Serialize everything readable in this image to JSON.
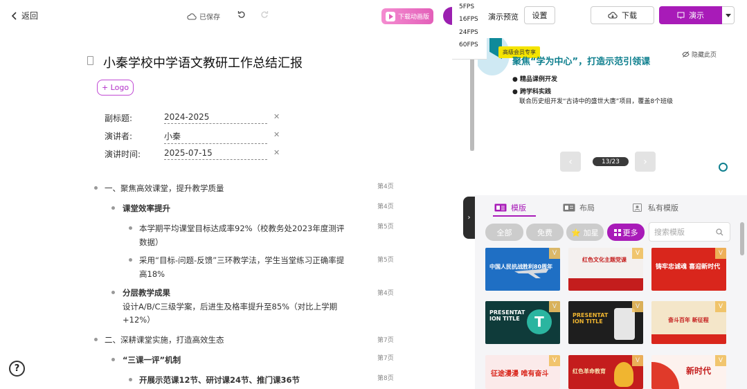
{
  "topbar": {
    "back_label": "返回",
    "saved_label": "已保存",
    "download_ppt_label": "下载动画版"
  },
  "outline": {
    "title": "小秦学校中学语文教研工作总结汇报",
    "logo_button": "+ Logo",
    "meta": [
      {
        "label": "副标题:",
        "value": "2024-2025"
      },
      {
        "label": "演讲者:",
        "value": "小秦"
      },
      {
        "label": "演讲时间:",
        "value": "2025-07-15"
      }
    ],
    "items": [
      {
        "text": "一、聚焦高效课堂，提升教学质量",
        "page": "第4页"
      },
      {
        "text": "课堂效率提升",
        "page": "第4页"
      },
      {
        "text": "本学期平均课堂目标达成率92%（校教务处2023年度测评数据）",
        "line1": "本学期平均课堂目标达成率92%（校教务处2023年度测评",
        "line2": "数据）",
        "page": "第5页"
      },
      {
        "text": "采用“目标-问题-反馈”三环教学法，学生当堂练习正确率提高18%",
        "line1": "采用“目标-问题-反馈”三环教学法，学生当堂练习正确率提",
        "line2": "高18%",
        "page": "第5页"
      },
      {
        "text": "分层教学成果",
        "page": "第4页"
      },
      {
        "text": "设计A/B/C三级学案，后进生及格率提升至85%（对比上学期+12%）",
        "line1": "设计A/B/C三级学案，后进生及格率提升至85%（对比上学期",
        "line2": "+12%）"
      },
      {
        "text": "二、深耕课堂实施，打造高效生态",
        "page": "第7页"
      },
      {
        "text": "“三课一评”机制",
        "page": "第7页"
      },
      {
        "text": "开展示范课12节、研讨课24节、推门课36节",
        "page": "第8页"
      }
    ],
    "help_label": "?"
  },
  "fps_menu": [
    "5FPS",
    "16FPS",
    "24FPS",
    "60FPS"
  ],
  "preview": {
    "label": "演示预览",
    "settings_label": "设置",
    "download_label": "下载",
    "present_label": "演示",
    "badge": "高级会员专享",
    "slide_heading": "聚焦“学为中心”，打造示范引领课",
    "hide_page_label": "隐藏此页",
    "slide_items": [
      {
        "text": "● 精品课例开发",
        "bold": true
      },
      {
        "text": "● 跨学科实践",
        "bold": true
      },
      {
        "text": "联合历史组开发“古诗中的盛世大唐”项目，覆盖8个班级",
        "bold": false
      }
    ],
    "counter": "13/23",
    "current_page": 13,
    "total_pages": 23
  },
  "templates": {
    "tabs": [
      {
        "label": "模版",
        "active": true
      },
      {
        "label": "布局",
        "active": false
      },
      {
        "label": "私有模版",
        "active": false
      }
    ],
    "chips": [
      {
        "label": "全部",
        "active": false
      },
      {
        "label": "免费",
        "active": false
      },
      {
        "label": "⭐ 加星",
        "active": false
      },
      {
        "label": "更多",
        "active": true
      }
    ],
    "search_placeholder": "搜索模版",
    "thumbs": [
      {
        "title": "中国人民抗战胜利80周年",
        "bg": "#1f6fc4"
      },
      {
        "title": "红色文化主题党课",
        "bg": "#f4f0ee"
      },
      {
        "title": "铸牢忠诚魂 喜迎新时代",
        "bg": "#d9261c"
      },
      {
        "title": "PRESENTAT ION TITLE",
        "bg": "#0f3b3a"
      },
      {
        "title": "PRESENTAT ION TITLE",
        "bg": "#1e1e1e"
      },
      {
        "title": "奋斗百年 新征程",
        "bg": "#f4e6c9"
      },
      {
        "title": "征途漫漫 唯有奋斗",
        "bg": "#d9261c"
      },
      {
        "title": "红色革命教育",
        "bg": "#c41d1d"
      },
      {
        "title": "新时代",
        "bg": "#e03a2a"
      }
    ]
  }
}
